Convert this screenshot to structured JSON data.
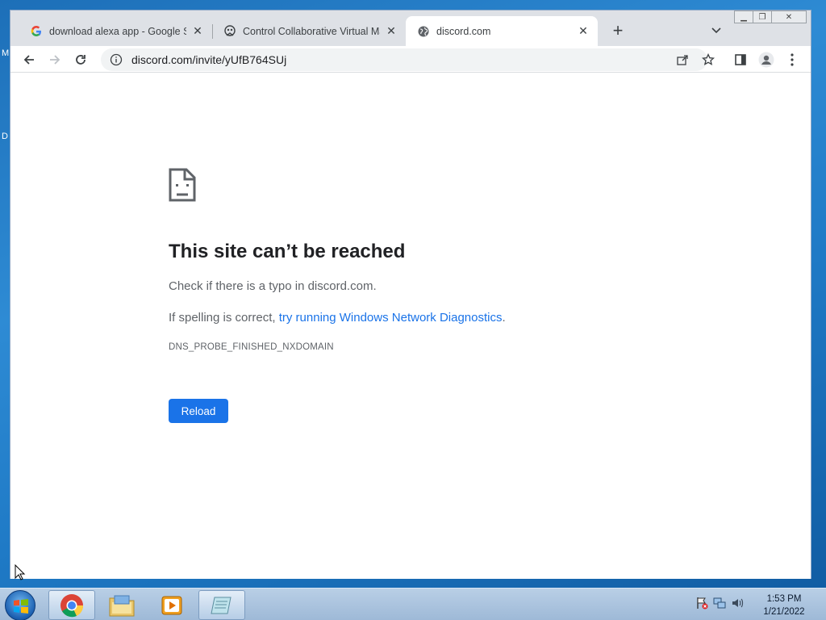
{
  "desktop": {
    "glyph_1": "M",
    "glyph_2": "D"
  },
  "tabs": [
    {
      "title": "download alexa app - Google Se",
      "icon": "google-icon"
    },
    {
      "title": "Control Collaborative Virtual Ma",
      "icon": "vm-icon"
    },
    {
      "title": "discord.com",
      "icon": "globe-icon"
    }
  ],
  "address_bar": {
    "url": "discord.com/invite/yUfB764SUj"
  },
  "error_page": {
    "title": "This site can’t be reached",
    "line1": "Check if there is a typo in discord.com.",
    "line2_prefix": "If spelling is correct, ",
    "line2_link": "try running Windows Network Diagnostics",
    "line2_suffix": ".",
    "code": "DNS_PROBE_FINISHED_NXDOMAIN",
    "reload_label": "Reload"
  },
  "taskbar": {
    "time": "1:53 PM",
    "date": "1/21/2022"
  },
  "colors": {
    "accent": "#1a73e8",
    "tabstrip": "#dee1e6",
    "desktop": "#1f7ac6"
  }
}
